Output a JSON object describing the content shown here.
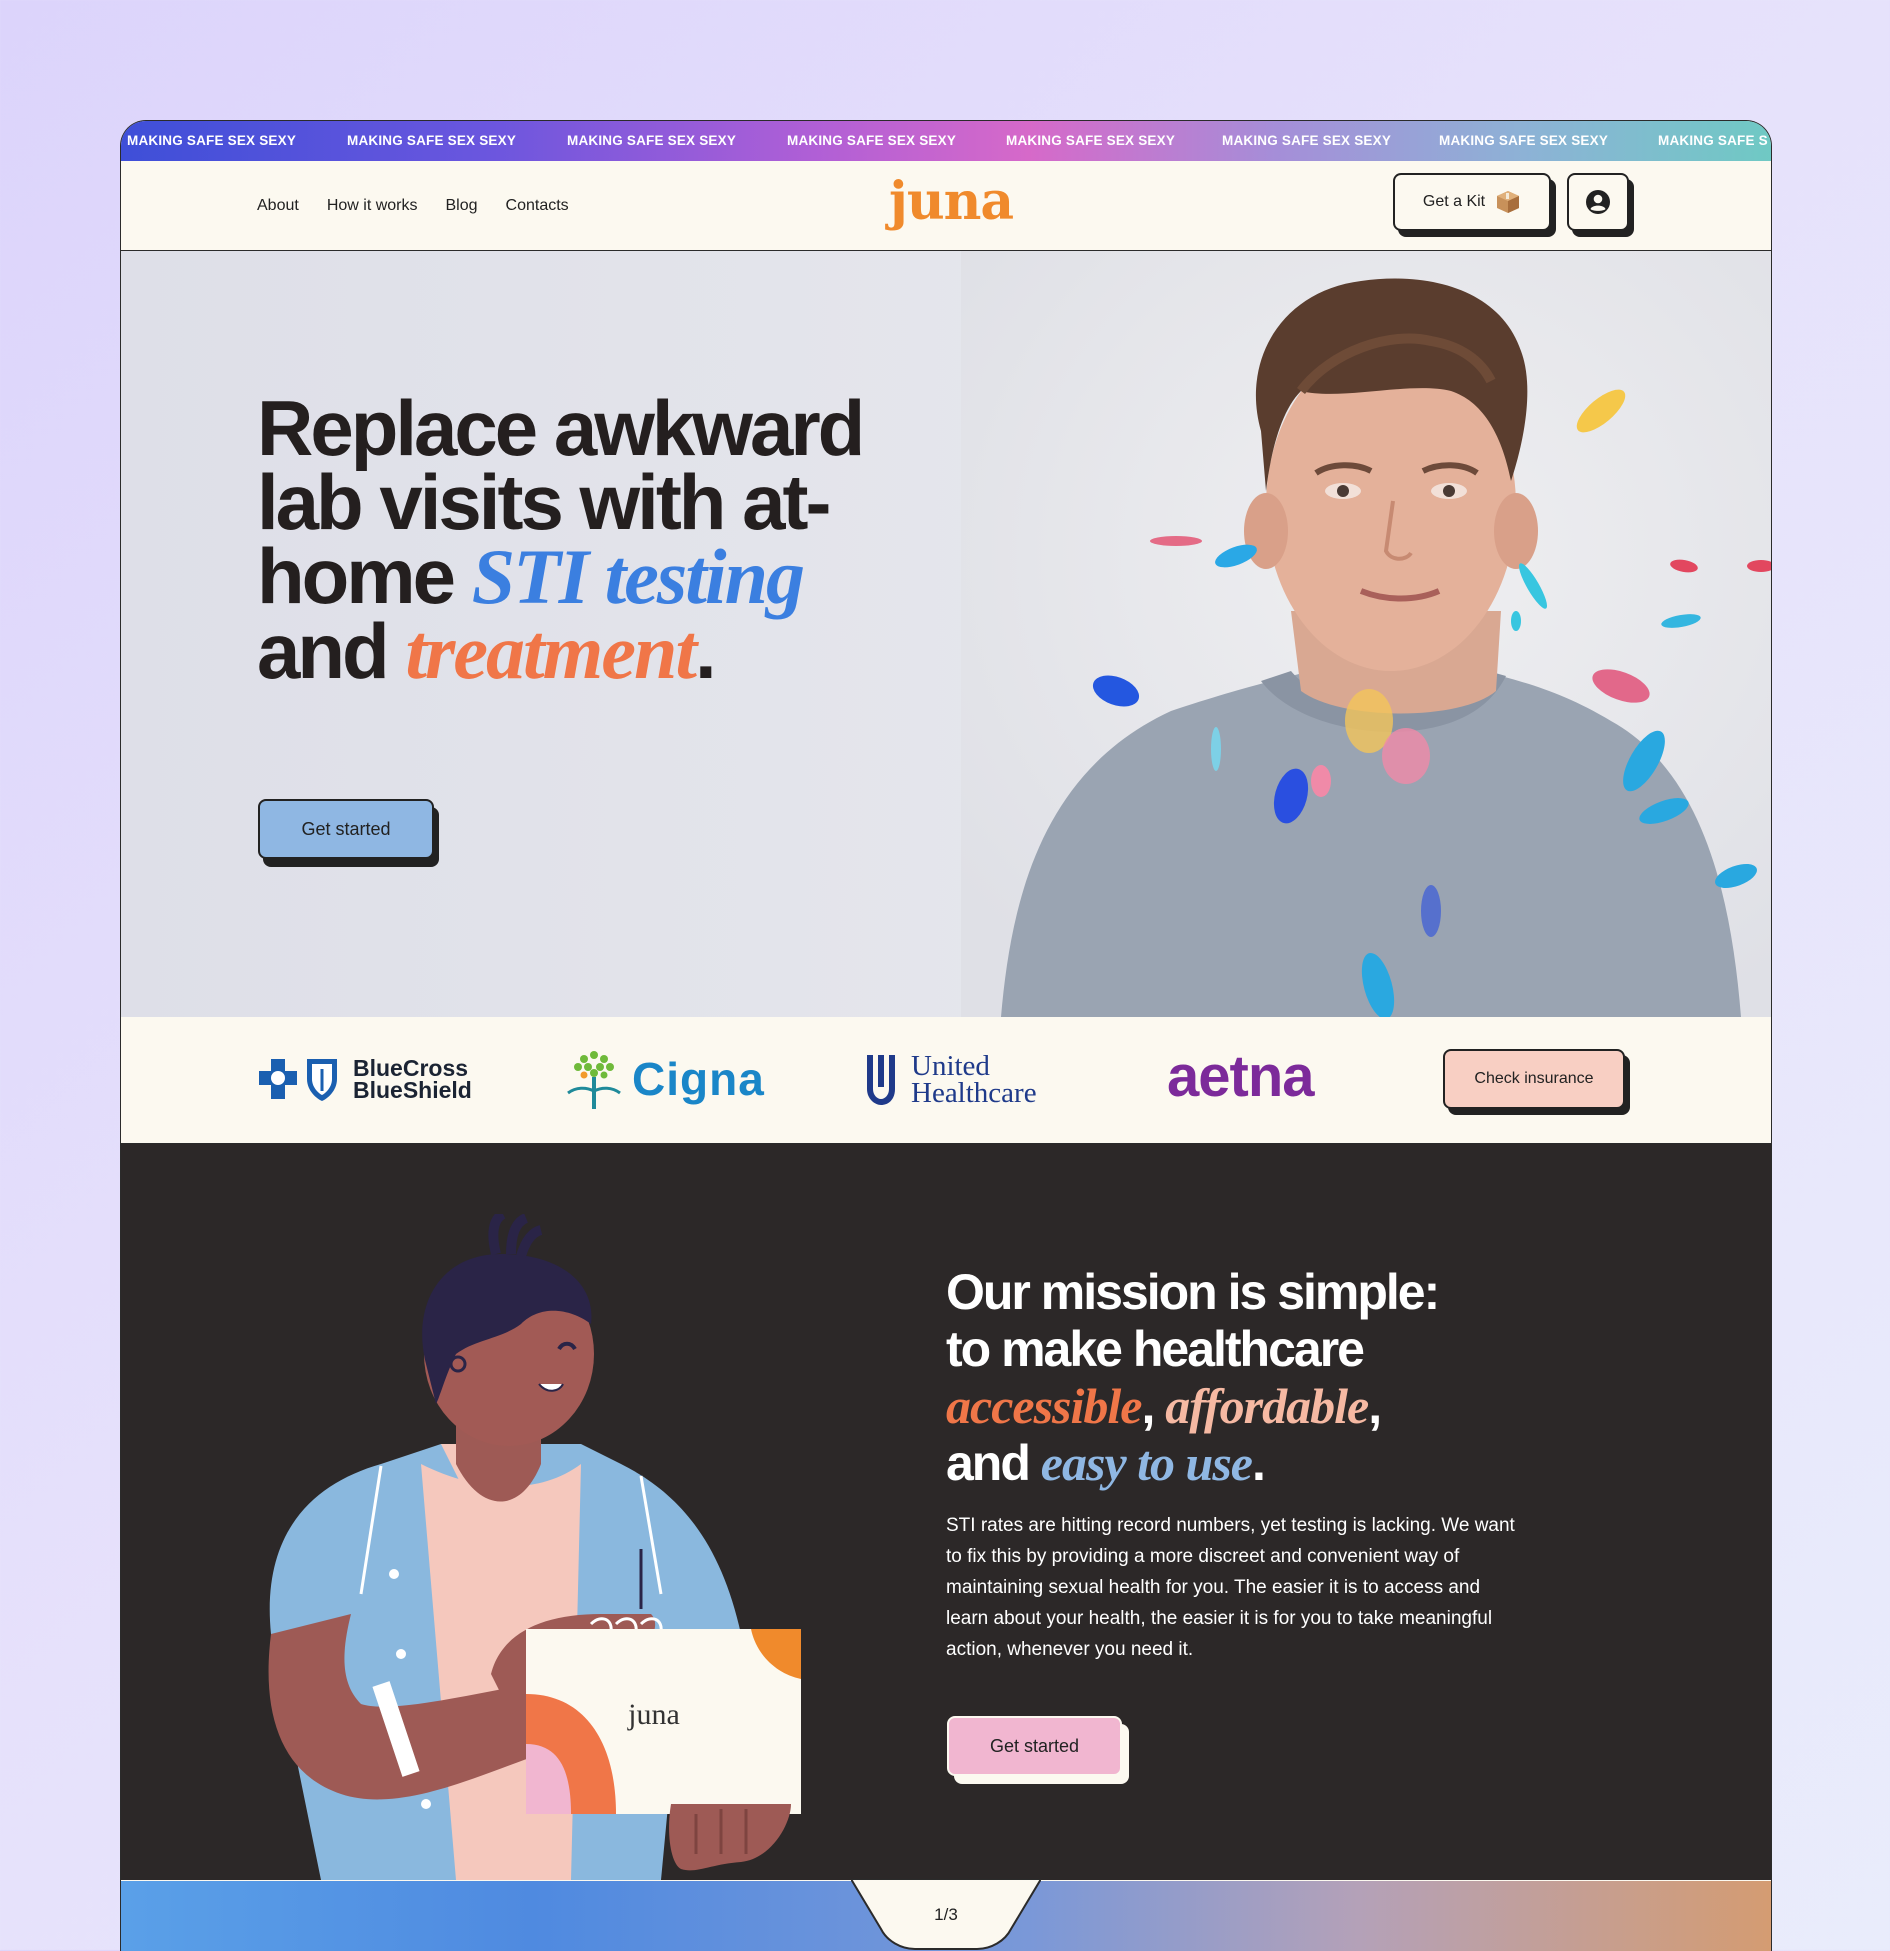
{
  "marquee": {
    "items": [
      "MAKING SAFE SEX SEXY",
      "MAKING SAFE SEX SEXY",
      "MAKING SAFE SEX SEXY",
      "MAKING SAFE SEX SEXY",
      "MAKING SAFE SEX SEXY",
      "MAKING SAFE SEX SEXY",
      "MAKING SAFE SEX SEXY",
      "MAKING SAFE S"
    ]
  },
  "nav": {
    "links": [
      "About",
      "How it works",
      "Blog",
      "Contacts"
    ],
    "logo": "juna",
    "kit_label": "Get a Kit",
    "kit_icon": "package-icon",
    "account_icon": "user-circle-icon"
  },
  "hero": {
    "headline_part1": "Replace awkward lab visits with at-home ",
    "headline_accent1": "STI testing",
    "headline_part2": " and ",
    "headline_accent2": "treatment",
    "headline_end": ".",
    "cta": "Get started"
  },
  "insurance": {
    "bcbs_line1": "BlueCross",
    "bcbs_line2": "BlueShield",
    "cigna": "Cigna",
    "uh_line1": "United",
    "uh_line2": "Healthcare",
    "aetna": "aetna",
    "cta": "Check insurance"
  },
  "mission": {
    "line1": "Our mission is simple:",
    "line2": "to make healthcare",
    "accent1": "accessible",
    "sep1": ", ",
    "accent2": "affordable",
    "sep2": ",",
    "line4a": "and ",
    "accent3": "easy to use",
    "line4end": ".",
    "body": "STI rates are hitting record numbers, yet testing is lacking. We want to fix this by providing a more discreet and convenient way of maintaining sexual health for you. The easier it is to access and learn about your health, the easier it is for you to take meaningful action, whenever you need it.",
    "cta": "Get started",
    "box_label": "juna"
  },
  "pager": {
    "label": "1/3"
  },
  "colors": {
    "accent_blue": "#3b7fe0",
    "accent_orange": "#f07648",
    "logo_orange": "#f08a2c",
    "dark_bg": "#2c2828",
    "cream": "#fcf9f0"
  }
}
